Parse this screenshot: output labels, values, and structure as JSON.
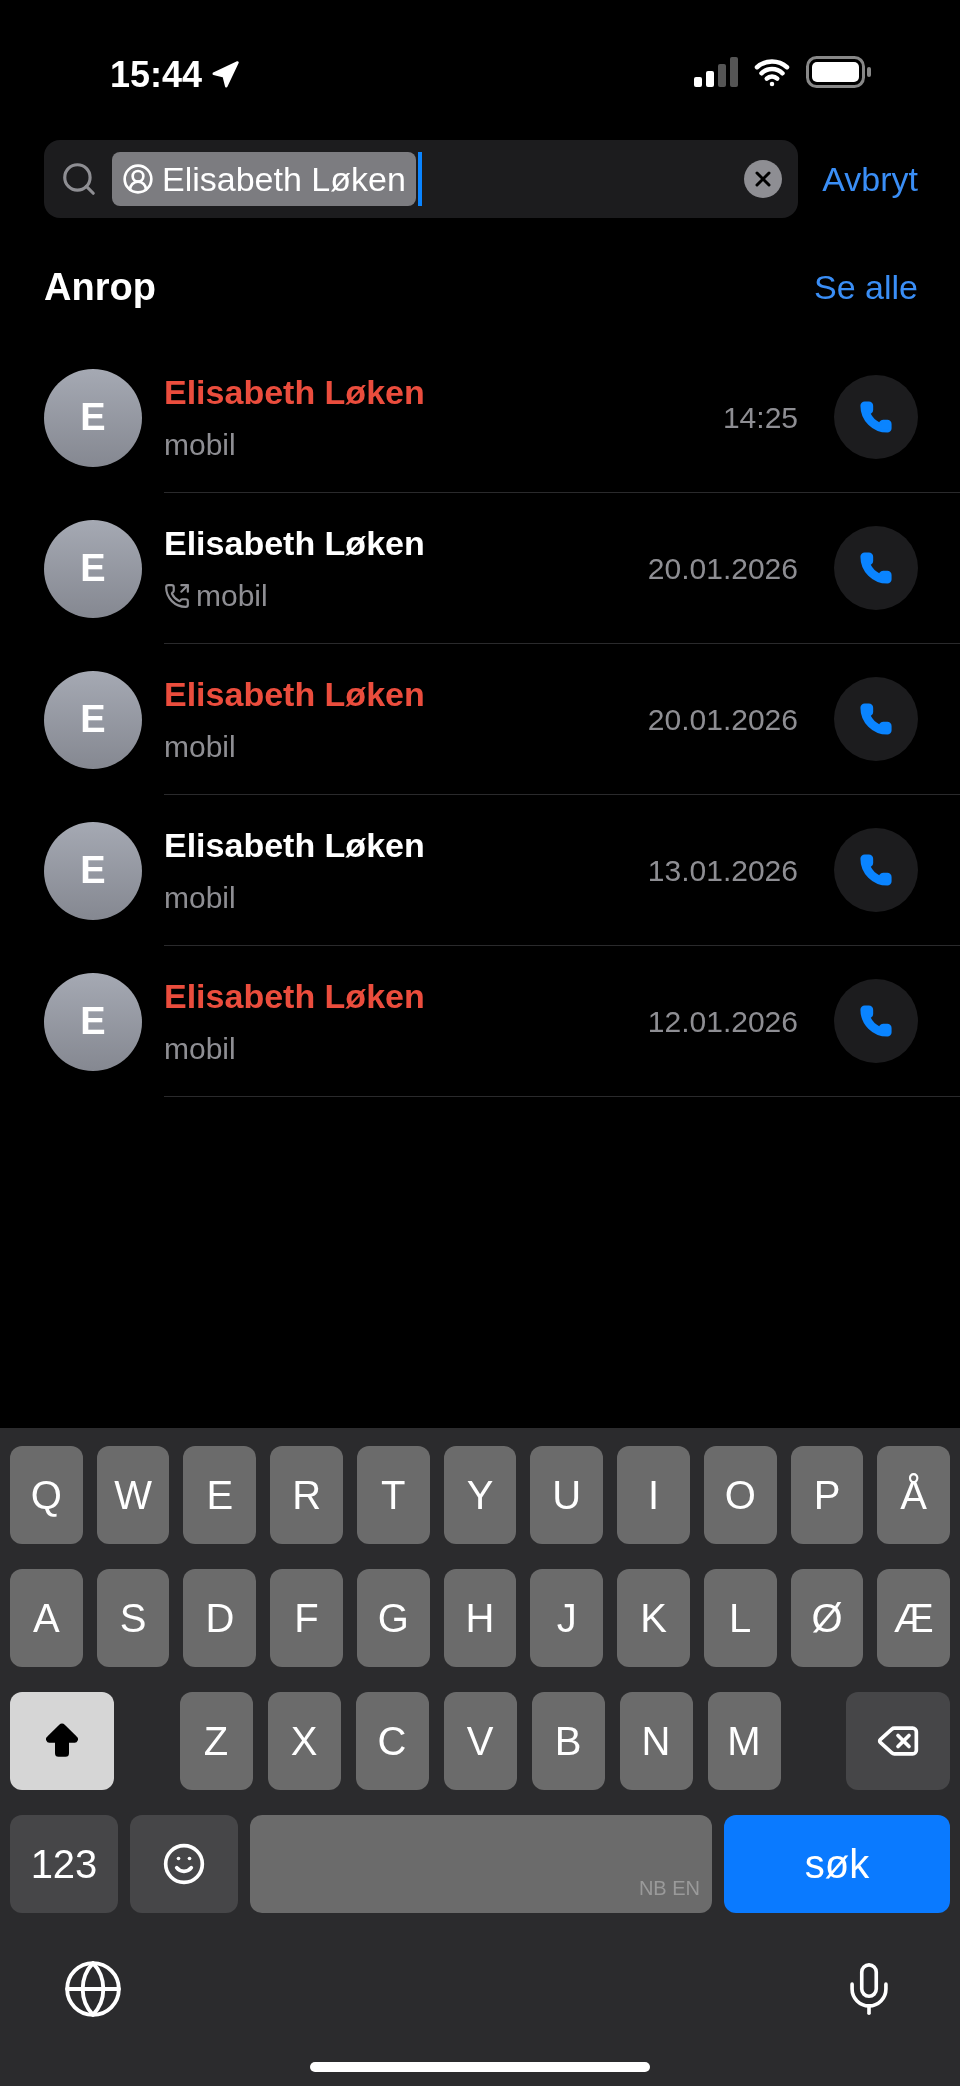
{
  "status_bar": {
    "time": "15:44"
  },
  "search": {
    "token": "Elisabeth Løken",
    "cancel": "Avbryt"
  },
  "section": {
    "title": "Anrop",
    "see_all": "Se alle"
  },
  "calls": [
    {
      "initial": "E",
      "name": "Elisabeth Løken",
      "missed": true,
      "outgoing": false,
      "type": "mobil",
      "time": "14:25"
    },
    {
      "initial": "E",
      "name": "Elisabeth Løken",
      "missed": false,
      "outgoing": true,
      "type": "mobil",
      "time": "20.01.2026"
    },
    {
      "initial": "E",
      "name": "Elisabeth Løken",
      "missed": true,
      "outgoing": false,
      "type": "mobil",
      "time": "20.01.2026"
    },
    {
      "initial": "E",
      "name": "Elisabeth Løken",
      "missed": false,
      "outgoing": false,
      "type": "mobil",
      "time": "13.01.2026"
    },
    {
      "initial": "E",
      "name": "Elisabeth Løken",
      "missed": true,
      "outgoing": false,
      "type": "mobil",
      "time": "12.01.2026"
    }
  ],
  "keyboard": {
    "top_row": [
      "Q",
      "W",
      "E",
      "R",
      "T",
      "Y",
      "U",
      "I",
      "O",
      "P",
      "Å"
    ],
    "middle_row": [
      "A",
      "S",
      "D",
      "F",
      "G",
      "H",
      "J",
      "K",
      "L",
      "Ø",
      "Æ"
    ],
    "bottom_row": [
      "Z",
      "X",
      "C",
      "V",
      "B",
      "N",
      "M"
    ],
    "shift_on": true,
    "number_key": "123",
    "space_hint": "NB EN",
    "return_key": "søk"
  }
}
